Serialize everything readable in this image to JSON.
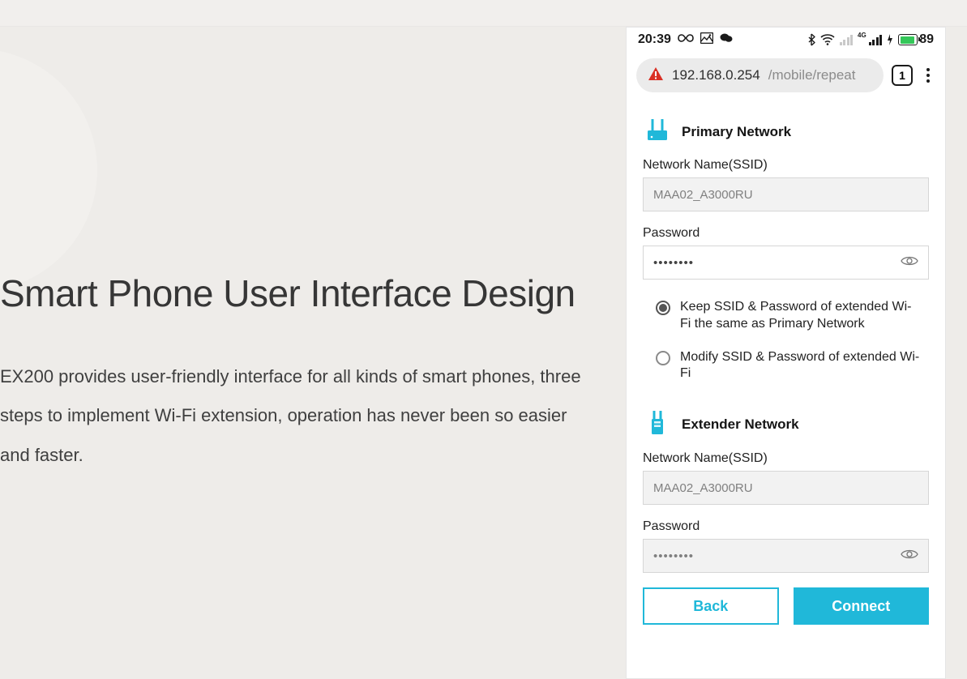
{
  "marketing": {
    "heading": "Smart Phone User Interface Design",
    "body": "EX200 provides user-friendly interface for all kinds of smart phones, three steps to implement  Wi-Fi extension, operation has never been so easier and faster."
  },
  "status_bar": {
    "time": "20:39",
    "battery_percent": "89"
  },
  "browser": {
    "url_host": "192.168.0.254",
    "url_path": "/mobile/repeat",
    "tab_count": "1"
  },
  "page": {
    "primary": {
      "title": "Primary Network",
      "ssid_label": "Network Name(SSID)",
      "ssid_value": "MAA02_A3000RU",
      "password_label": "Password",
      "password_mask": "••••••••"
    },
    "options": {
      "keep": "Keep SSID & Password of extended Wi-Fi the same as Primary Network",
      "modify": "Modify SSID & Password of extended Wi-Fi",
      "selected": "keep"
    },
    "extender": {
      "title": "Extender Network",
      "ssid_label": "Network Name(SSID)",
      "ssid_value": "MAA02_A3000RU",
      "password_label": "Password",
      "password_mask": "••••••••"
    },
    "buttons": {
      "back": "Back",
      "connect": "Connect"
    }
  }
}
